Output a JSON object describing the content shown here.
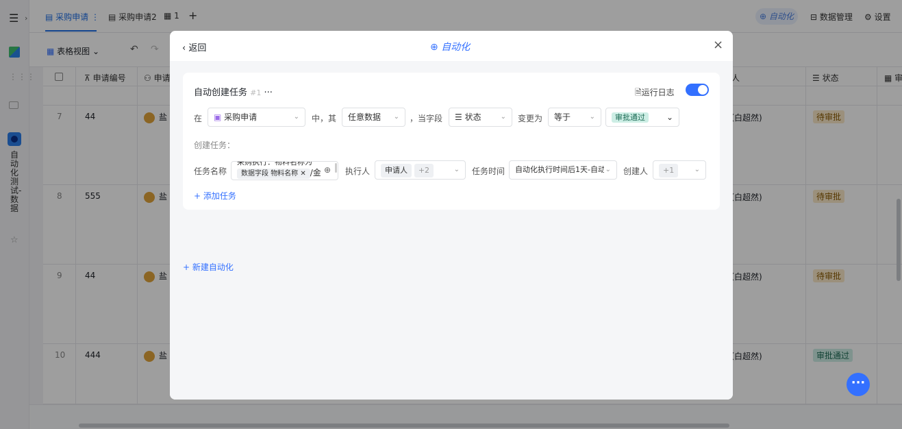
{
  "rail": {
    "vertical_title": "自动化测试-数据"
  },
  "tabs": [
    {
      "label": "采购申请"
    },
    {
      "label": "采购申请2"
    },
    {
      "label": "1"
    }
  ],
  "topbar": {
    "add_tab": "+",
    "automation": "自动化",
    "data_mgmt": "数据管理",
    "settings": "设置"
  },
  "toolbar": {
    "view": "表格视图"
  },
  "table": {
    "headers": {
      "id": "申请编号",
      "applicant": "申请",
      "person": "人",
      "status": "状态",
      "extra": "审"
    },
    "rows": [
      {
        "index": "7",
        "id": "44",
        "name": "盐",
        "person": "（白超然)",
        "status": "待审批"
      },
      {
        "index": "8",
        "id": "555",
        "name": "盐",
        "person": "（白超然)",
        "status": "待审批"
      },
      {
        "index": "9",
        "id": "44",
        "name": "盐",
        "person": "（白超然)",
        "status": "待审批"
      },
      {
        "index": "10",
        "id": "444",
        "name": "盐",
        "person": "（白超然)",
        "status": "审批通过"
      }
    ]
  },
  "modal": {
    "back": "返回",
    "title": "自动化",
    "close": "×",
    "card": {
      "name": "自动创建任务",
      "badge": "#1",
      "more": "···",
      "run_log": "运行日志",
      "trigger": {
        "in": "在",
        "table": "采购申请",
        "middle": "中，其",
        "record_scope": "任意数据",
        "when_field": "，当字段",
        "field": "状态",
        "changes_to": "变更为",
        "operator": "等于",
        "value": "审批通过"
      },
      "create_task_label": "创建任务：",
      "task": {
        "name_label": "任务名称",
        "name_text_line1": "采购执行：物料名称为",
        "field_chip": "数据字段",
        "field_name": "物料名称",
        "name_suffix": "/金",
        "assignee_label": "执行人",
        "assignee_chip": "申请人",
        "assignee_more": "+2",
        "time_label": "任务时间",
        "time_value": "自动化执行时间后1天-自动",
        "creator_label": "创建人",
        "creator_more": "+1"
      },
      "add_task": "+ 添加任务"
    },
    "new_automation": "+ 新建自动化"
  }
}
